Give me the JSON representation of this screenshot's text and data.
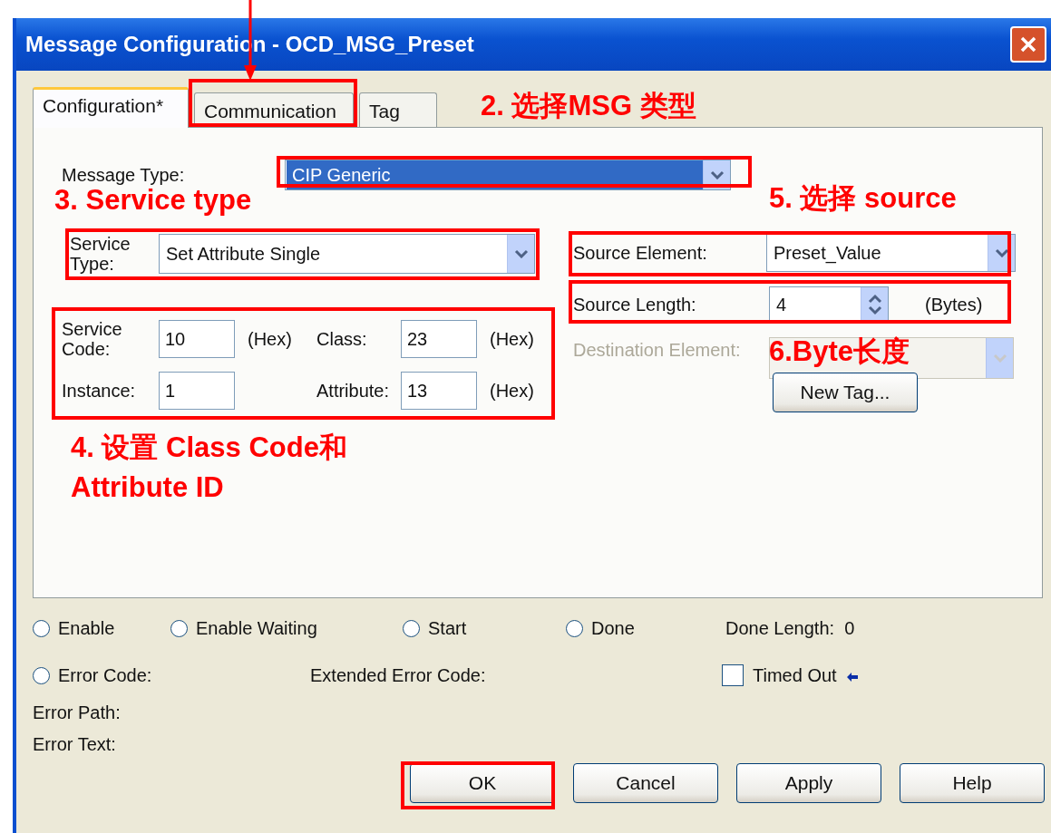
{
  "window": {
    "title": "Message Configuration - OCD_MSG_Preset"
  },
  "tabs": [
    {
      "label": "Configuration*",
      "selected": true
    },
    {
      "label": "Communication",
      "selected": false
    },
    {
      "label": "Tag",
      "selected": false
    }
  ],
  "message_type": {
    "label": "Message Type:",
    "value": "CIP Generic"
  },
  "service_type": {
    "label": "Service Type:",
    "value": "Set Attribute Single"
  },
  "fields": [
    {
      "label": "Service Code:",
      "value": "10",
      "unit": "(Hex)"
    },
    {
      "label": "Class:",
      "value": "23",
      "unit": "(Hex)"
    },
    {
      "label": "Instance:",
      "value": "1"
    },
    {
      "label": "Attribute:",
      "value": "13",
      "unit": "(Hex)"
    }
  ],
  "source_element": {
    "label": "Source Element:",
    "value": "Preset_Value"
  },
  "source_length": {
    "label": "Source Length:",
    "value": "4",
    "unit": "(Bytes)"
  },
  "destination_element": {
    "label": "Destination Element:",
    "disabled": true
  },
  "new_tag_button": "New Tag...",
  "status": [
    {
      "label": "Enable",
      "checked": false
    },
    {
      "label": "Enable Waiting",
      "checked": false
    },
    {
      "label": "Start",
      "checked": false
    },
    {
      "label": "Done",
      "checked": false
    }
  ],
  "done_length": "Done Length:  0",
  "error_code": {
    "label": "Error Code:",
    "checked": false
  },
  "extended_error_code": "Extended Error Code:",
  "timed_out": {
    "label": "Timed Out",
    "checked": false
  },
  "error_path": "Error Path:",
  "error_text": "Error Text:",
  "buttons": [
    "OK",
    "Cancel",
    "Apply",
    "Help"
  ],
  "annotations": [
    {
      "text": "2. 选择MSG 类型"
    },
    {
      "text": "3. Service type"
    },
    {
      "text": "5. 选择 source"
    },
    {
      "text": "6.Byte长度"
    },
    {
      "text": "4. 设置 Class Code和 Attribute ID"
    }
  ]
}
